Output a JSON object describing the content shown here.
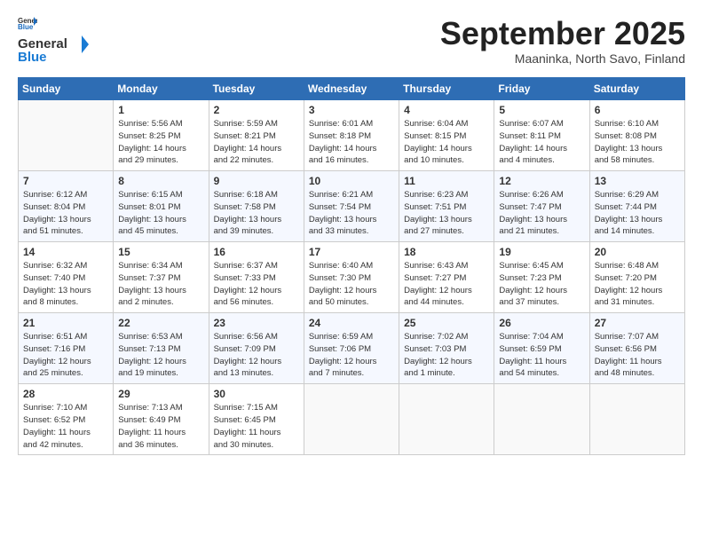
{
  "logo": {
    "general": "General",
    "blue": "Blue"
  },
  "title": "September 2025",
  "subtitle": "Maaninka, North Savo, Finland",
  "days_header": [
    "Sunday",
    "Monday",
    "Tuesday",
    "Wednesday",
    "Thursday",
    "Friday",
    "Saturday"
  ],
  "weeks": [
    [
      {
        "day": "",
        "info": ""
      },
      {
        "day": "1",
        "info": "Sunrise: 5:56 AM\nSunset: 8:25 PM\nDaylight: 14 hours\nand 29 minutes."
      },
      {
        "day": "2",
        "info": "Sunrise: 5:59 AM\nSunset: 8:21 PM\nDaylight: 14 hours\nand 22 minutes."
      },
      {
        "day": "3",
        "info": "Sunrise: 6:01 AM\nSunset: 8:18 PM\nDaylight: 14 hours\nand 16 minutes."
      },
      {
        "day": "4",
        "info": "Sunrise: 6:04 AM\nSunset: 8:15 PM\nDaylight: 14 hours\nand 10 minutes."
      },
      {
        "day": "5",
        "info": "Sunrise: 6:07 AM\nSunset: 8:11 PM\nDaylight: 14 hours\nand 4 minutes."
      },
      {
        "day": "6",
        "info": "Sunrise: 6:10 AM\nSunset: 8:08 PM\nDaylight: 13 hours\nand 58 minutes."
      }
    ],
    [
      {
        "day": "7",
        "info": "Sunrise: 6:12 AM\nSunset: 8:04 PM\nDaylight: 13 hours\nand 51 minutes."
      },
      {
        "day": "8",
        "info": "Sunrise: 6:15 AM\nSunset: 8:01 PM\nDaylight: 13 hours\nand 45 minutes."
      },
      {
        "day": "9",
        "info": "Sunrise: 6:18 AM\nSunset: 7:58 PM\nDaylight: 13 hours\nand 39 minutes."
      },
      {
        "day": "10",
        "info": "Sunrise: 6:21 AM\nSunset: 7:54 PM\nDaylight: 13 hours\nand 33 minutes."
      },
      {
        "day": "11",
        "info": "Sunrise: 6:23 AM\nSunset: 7:51 PM\nDaylight: 13 hours\nand 27 minutes."
      },
      {
        "day": "12",
        "info": "Sunrise: 6:26 AM\nSunset: 7:47 PM\nDaylight: 13 hours\nand 21 minutes."
      },
      {
        "day": "13",
        "info": "Sunrise: 6:29 AM\nSunset: 7:44 PM\nDaylight: 13 hours\nand 14 minutes."
      }
    ],
    [
      {
        "day": "14",
        "info": "Sunrise: 6:32 AM\nSunset: 7:40 PM\nDaylight: 13 hours\nand 8 minutes."
      },
      {
        "day": "15",
        "info": "Sunrise: 6:34 AM\nSunset: 7:37 PM\nDaylight: 13 hours\nand 2 minutes."
      },
      {
        "day": "16",
        "info": "Sunrise: 6:37 AM\nSunset: 7:33 PM\nDaylight: 12 hours\nand 56 minutes."
      },
      {
        "day": "17",
        "info": "Sunrise: 6:40 AM\nSunset: 7:30 PM\nDaylight: 12 hours\nand 50 minutes."
      },
      {
        "day": "18",
        "info": "Sunrise: 6:43 AM\nSunset: 7:27 PM\nDaylight: 12 hours\nand 44 minutes."
      },
      {
        "day": "19",
        "info": "Sunrise: 6:45 AM\nSunset: 7:23 PM\nDaylight: 12 hours\nand 37 minutes."
      },
      {
        "day": "20",
        "info": "Sunrise: 6:48 AM\nSunset: 7:20 PM\nDaylight: 12 hours\nand 31 minutes."
      }
    ],
    [
      {
        "day": "21",
        "info": "Sunrise: 6:51 AM\nSunset: 7:16 PM\nDaylight: 12 hours\nand 25 minutes."
      },
      {
        "day": "22",
        "info": "Sunrise: 6:53 AM\nSunset: 7:13 PM\nDaylight: 12 hours\nand 19 minutes."
      },
      {
        "day": "23",
        "info": "Sunrise: 6:56 AM\nSunset: 7:09 PM\nDaylight: 12 hours\nand 13 minutes."
      },
      {
        "day": "24",
        "info": "Sunrise: 6:59 AM\nSunset: 7:06 PM\nDaylight: 12 hours\nand 7 minutes."
      },
      {
        "day": "25",
        "info": "Sunrise: 7:02 AM\nSunset: 7:03 PM\nDaylight: 12 hours\nand 1 minute."
      },
      {
        "day": "26",
        "info": "Sunrise: 7:04 AM\nSunset: 6:59 PM\nDaylight: 11 hours\nand 54 minutes."
      },
      {
        "day": "27",
        "info": "Sunrise: 7:07 AM\nSunset: 6:56 PM\nDaylight: 11 hours\nand 48 minutes."
      }
    ],
    [
      {
        "day": "28",
        "info": "Sunrise: 7:10 AM\nSunset: 6:52 PM\nDaylight: 11 hours\nand 42 minutes."
      },
      {
        "day": "29",
        "info": "Sunrise: 7:13 AM\nSunset: 6:49 PM\nDaylight: 11 hours\nand 36 minutes."
      },
      {
        "day": "30",
        "info": "Sunrise: 7:15 AM\nSunset: 6:45 PM\nDaylight: 11 hours\nand 30 minutes."
      },
      {
        "day": "",
        "info": ""
      },
      {
        "day": "",
        "info": ""
      },
      {
        "day": "",
        "info": ""
      },
      {
        "day": "",
        "info": ""
      }
    ]
  ]
}
